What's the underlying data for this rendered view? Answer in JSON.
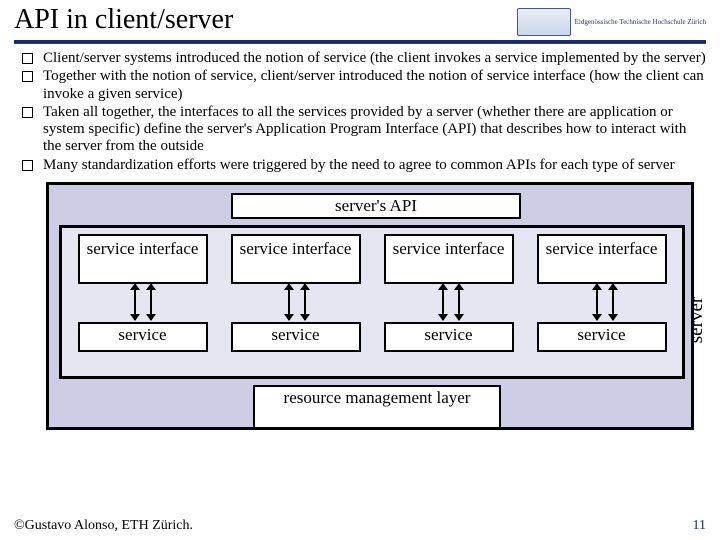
{
  "title": "API in client/server",
  "logo_text": "Eidgenössische Technische Hochschule Zürich",
  "bullets": [
    "Client/server systems introduced the notion of service (the client invokes a service implemented by the server)",
    "Together with the notion of service, client/server introduced the notion of service interface (how the client can invoke a given service)",
    "Taken all together, the interfaces to all the services provided by a server (whether there are application or system specific) define the server's Application Program Interface (API) that describes how to interact with the server from the outside",
    "Many standardization efforts were triggered by the need to agree to common APIs for each type of server"
  ],
  "diagram": {
    "api_label": "server's API",
    "interface_label": "service interface",
    "service_label": "service",
    "rml_label": "resource management layer",
    "server_label": "server",
    "columns": 4
  },
  "footer": {
    "copyright": "©Gustavo Alonso,  ETH Zürich.",
    "page": "11"
  }
}
